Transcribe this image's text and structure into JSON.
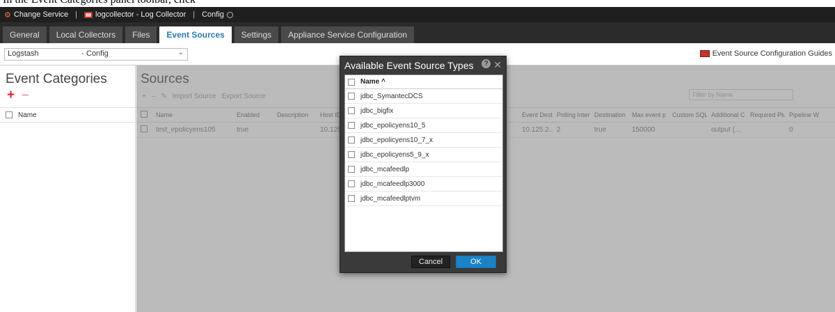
{
  "caption": {
    "text": "In the Event Categories panel toolbar, click"
  },
  "titlebar": {
    "change_service": "Change Service",
    "service_name": "logcollector - Log Collector",
    "config": "Config"
  },
  "tabs": [
    {
      "label": "General"
    },
    {
      "label": "Local Collectors"
    },
    {
      "label": "Files"
    },
    {
      "label": "Event Sources"
    },
    {
      "label": "Settings"
    },
    {
      "label": "Appliance Service Configuration"
    }
  ],
  "toolbar": {
    "collector_select": "Logstash",
    "type_select": "Config",
    "guides_label": "Event Source Configuration Guides"
  },
  "left_panel": {
    "title": "Event Categories",
    "column_name": "Name"
  },
  "main": {
    "title": "Sources",
    "toolbar_items": [
      "Import Source",
      "Export Source",
      "Filter by Name"
    ],
    "filter_placeholder": "Filter by Name",
    "columns": [
      "Name",
      "Enabled",
      "Description",
      "Host ID",
      "Event Destin",
      "Polling Interv",
      "Destination",
      "Max event p",
      "Custom SQL",
      "Additional C",
      "Required Plu",
      "Pipeline W"
    ],
    "row": {
      "name": "test_epolicyens105",
      "enabled": "true",
      "host": "10.125.",
      "event_dest": "10.125.2...",
      "polling": "2",
      "destination": "true",
      "max_event": "150000",
      "additional": "output {...",
      "pipeline": "0"
    }
  },
  "modal": {
    "title": "Available Event Source Types",
    "column_name": "Name ^",
    "items": [
      "jdbc_SymantecDCS",
      "jdbc_bigfix",
      "jdbc_epolicyens10_5",
      "jdbc_epolicyens10_7_x",
      "jdbc_epolicyens5_9_x",
      "jdbc_mcafeedlp",
      "jdbc_mcafeedlp3000",
      "jdbc_mcafeedlptvm"
    ],
    "cancel": "Cancel",
    "ok": "OK"
  }
}
